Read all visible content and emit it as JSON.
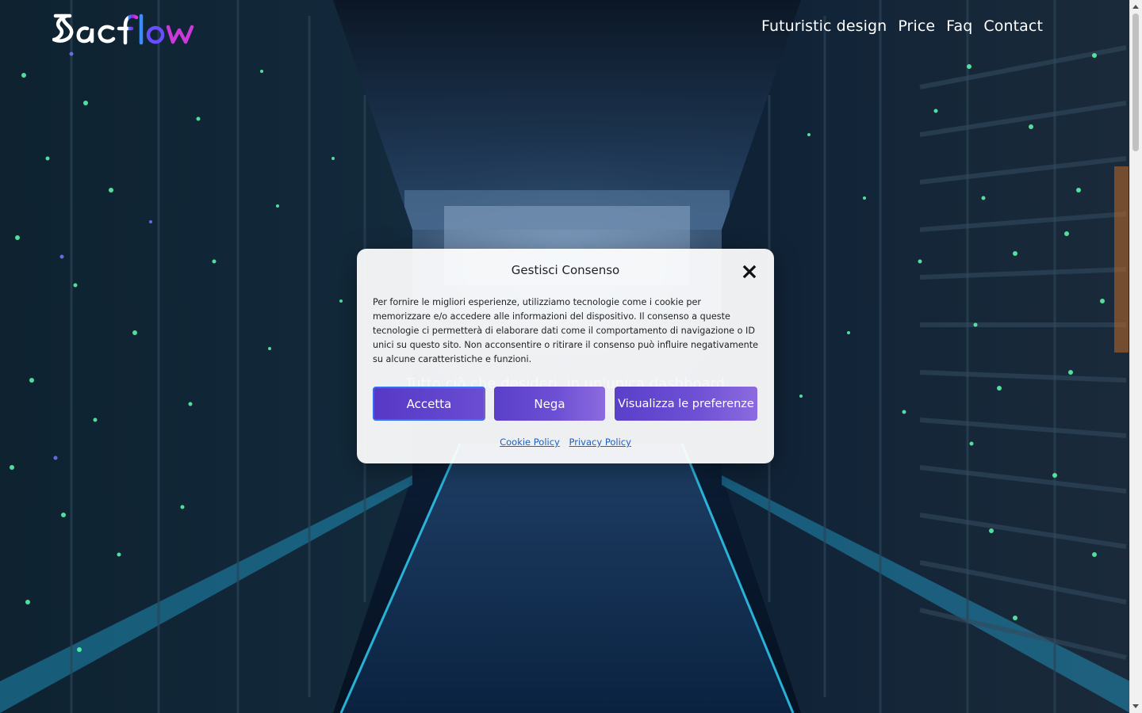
{
  "brand": {
    "logo_text": "Sacflow",
    "gradient_colors": [
      "#3d8cff",
      "#8a2be2",
      "#e23ad0"
    ]
  },
  "nav": {
    "items": [
      {
        "label": "Futuristic design"
      },
      {
        "label": "Price"
      },
      {
        "label": "Faq"
      },
      {
        "label": "Contact"
      }
    ]
  },
  "hero": {
    "subtitle": "Tutto ciò che desideri, in un'unica dashboard"
  },
  "consent": {
    "title": "Gestisci Consenso",
    "body": "Per fornire le migliori esperienze, utilizziamo tecnologie come i cookie per memorizzare e/o accedere alle informazioni del dispositivo. Il consenso a queste tecnologie ci permetterà di elaborare dati come il comportamento di navigazione o ID unici su questo sito. Non acconsentire o ritirare il consenso può influire negativamente su alcune caratteristiche e funzioni.",
    "accept_label": "Accetta",
    "deny_label": "Nega",
    "preferences_label": "Visualizza le preferenze",
    "cookie_policy_label": "Cookie Policy",
    "privacy_policy_label": "Privacy Policy",
    "close_icon": "close-icon"
  },
  "colors": {
    "button_start": "#5a3fc9",
    "button_end": "#8c6be0",
    "link": "#1e5fbf"
  }
}
